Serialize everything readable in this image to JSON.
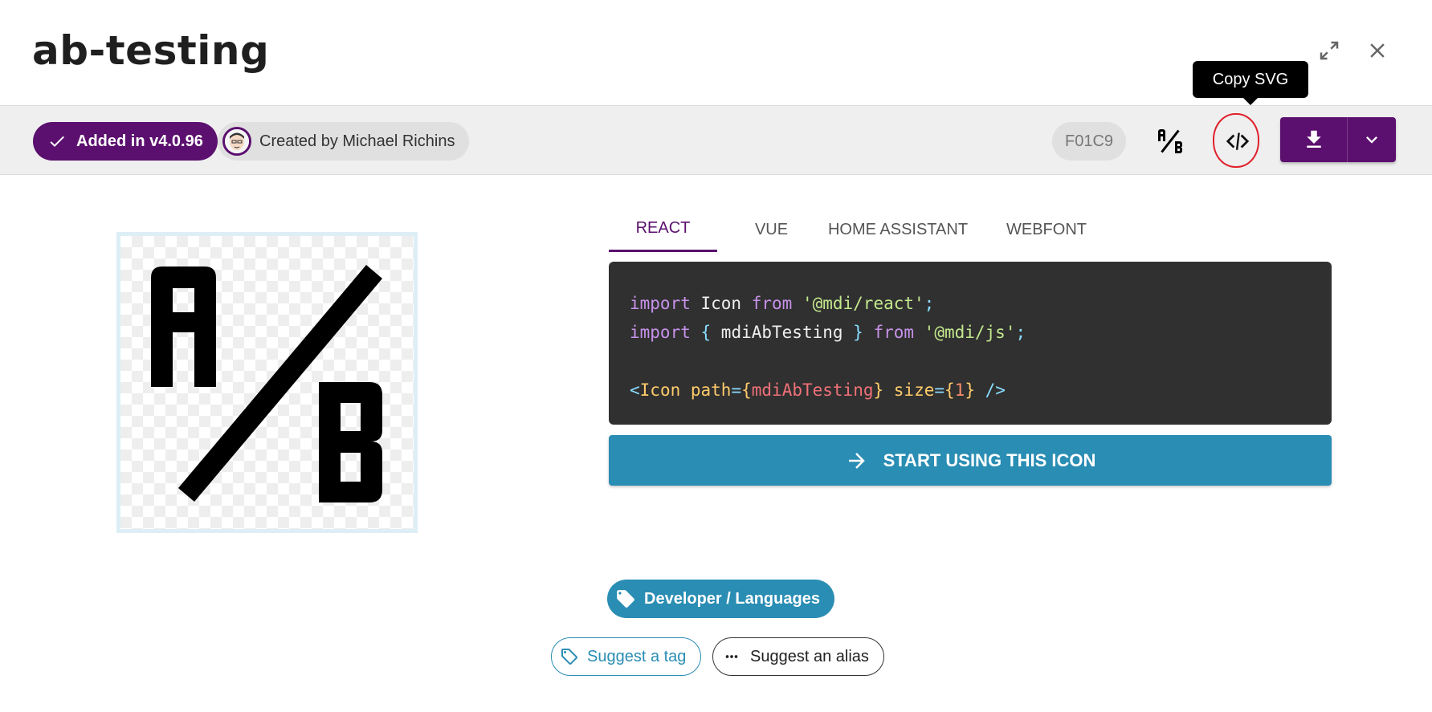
{
  "header": {
    "title": "ab-testing",
    "expand_icon": "arrow-expand-icon",
    "close_icon": "close-icon"
  },
  "tooltip": {
    "text": "Copy SVG"
  },
  "toolbar": {
    "added_label": "Added in v4.0.96",
    "creator_label": "Created by Michael Richins",
    "codepoint": "F01C9",
    "preview_icon": "ab-testing-icon",
    "copy_svg_icon": "code-tags-icon",
    "download_icon": "download-icon",
    "download_more_icon": "chevron-down-icon"
  },
  "tabs": [
    {
      "label": "REACT",
      "active": true
    },
    {
      "label": "VUE",
      "active": false
    },
    {
      "label": "HOME ASSISTANT",
      "active": false
    },
    {
      "label": "WEBFONT",
      "active": false
    }
  ],
  "code": {
    "line1": {
      "kw1": "import",
      "name": " Icon ",
      "kw2": "from",
      "str": " '@mdi/react'",
      "end": ";"
    },
    "line2": {
      "kw1": "import",
      "open": " { ",
      "name": "mdiAbTesting",
      "close": " } ",
      "kw2": "from",
      "str": " '@mdi/js'",
      "end": ";"
    },
    "line3": {
      "lt": "<",
      "tag": "Icon",
      "attr1": " path",
      "eq1": "=",
      "ob1": "{",
      "var": "mdiAbTesting",
      "cb1": "}",
      "attr2": " size",
      "eq2": "=",
      "ob2": "{",
      "num": "1",
      "cb2": "}",
      "close": " />"
    }
  },
  "start_button": {
    "label": "START USING THIS ICON",
    "icon": "arrow-right-icon"
  },
  "tags": {
    "category": "Developer / Languages",
    "category_icon": "tag-icon",
    "suggest_tag": "Suggest a tag",
    "suggest_tag_icon": "tag-outline-icon",
    "suggest_alias": "Suggest an alias",
    "suggest_alias_icon": "dots-horizontal-icon"
  },
  "colors": {
    "brand": "#5b0f6e",
    "accent": "#2a8db3",
    "code_bg": "#303030"
  }
}
